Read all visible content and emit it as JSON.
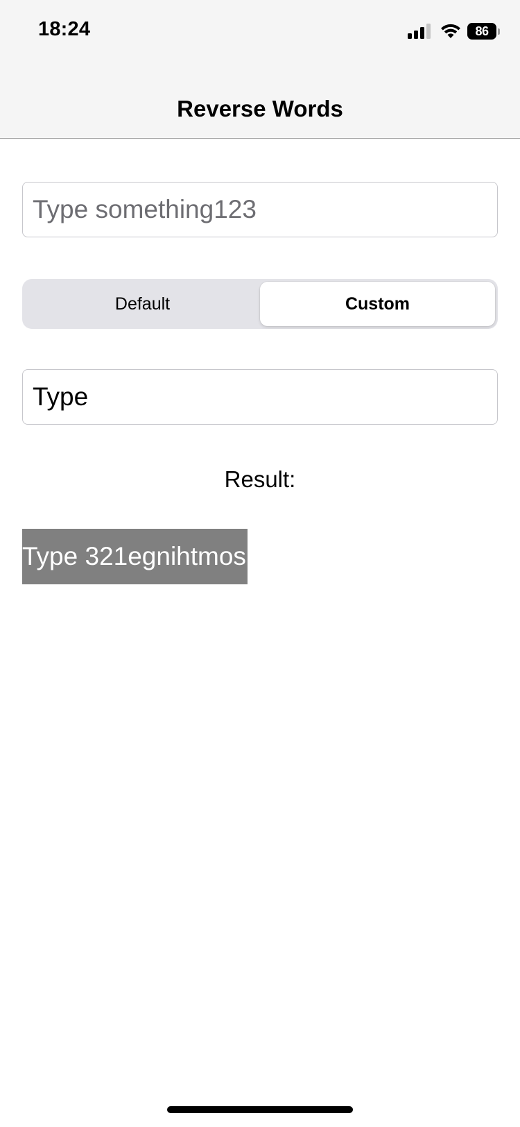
{
  "status_bar": {
    "time": "18:24",
    "battery_level": "86",
    "icons": [
      "signal-icon",
      "wifi-icon",
      "battery-icon"
    ]
  },
  "nav": {
    "title": "Reverse Words"
  },
  "input": {
    "value": "",
    "placeholder": "Type something123"
  },
  "segmented_control": {
    "options": [
      "Default",
      "Custom"
    ],
    "selected": "Custom"
  },
  "custom_input": {
    "value": "Type",
    "placeholder": ""
  },
  "result": {
    "label": "Result:",
    "value": "Type 321egnihtmos"
  },
  "colors": {
    "nav_background": "#f5f5f5",
    "result_highlight": "#808080",
    "segment_track": "#e3e3e8"
  }
}
